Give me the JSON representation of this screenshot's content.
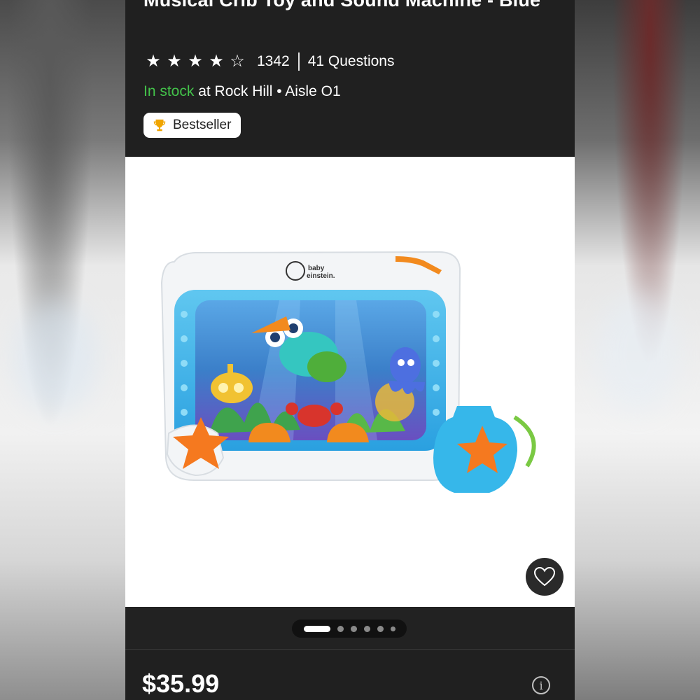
{
  "product": {
    "title": "Musical Crib Toy and Sound Machine - Blue",
    "rating_value": 4,
    "rating_max": 5,
    "review_count": "1342",
    "questions": "41 Questions",
    "stock_status": "In stock",
    "location": " at Rock Hill • Aisle O1",
    "badge": "Bestseller",
    "price": "$35.99",
    "image_brand": "baby einstein"
  },
  "carousel": {
    "total_dots": 6,
    "active_index": 0
  },
  "icons": {
    "star": "star-icon",
    "trophy": "trophy-icon",
    "favorite": "heart-icon",
    "info": "info-icon"
  },
  "colors": {
    "in_stock": "#43c24a",
    "background": "#202020"
  }
}
